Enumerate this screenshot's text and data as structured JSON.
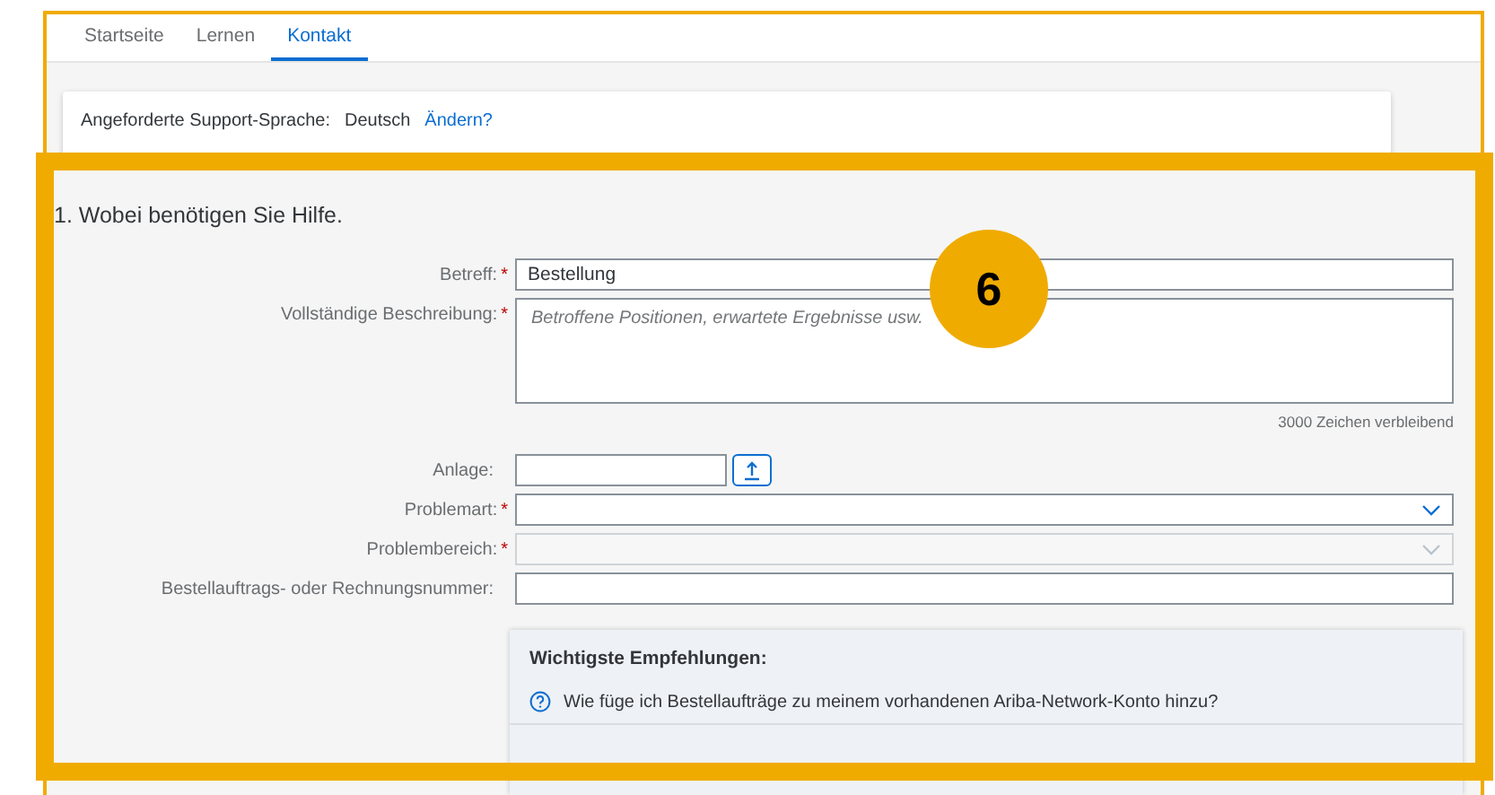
{
  "tabs": [
    {
      "label": "Startseite",
      "selected": false
    },
    {
      "label": "Lernen",
      "selected": false
    },
    {
      "label": "Kontakt",
      "selected": true
    }
  ],
  "language_notice": {
    "label": "Angeforderte Support-Sprache:",
    "value": "Deutsch",
    "link": "Ändern?"
  },
  "section_title": "1. Wobei benötigen Sie Hilfe.",
  "fields": [
    {
      "kind": "text",
      "label": "Betreff:",
      "required_mark": "*",
      "value": "Bestellung"
    },
    {
      "kind": "textarea",
      "label": "Vollständige Beschreibung:",
      "required_mark": "*",
      "placeholder": "Betroffene Positionen, erwartete Ergebnisse usw.",
      "counter": "3000 Zeichen verbleibend"
    },
    {
      "kind": "file",
      "label": "Anlage:"
    },
    {
      "kind": "select",
      "label": "Problemart:",
      "required_mark": "*",
      "disabled": false
    },
    {
      "kind": "select",
      "label": "Problembereich:",
      "required_mark": "*",
      "disabled": true
    },
    {
      "kind": "text",
      "label": "Bestellauftrags- oder Rechnungsnummer:"
    }
  ],
  "recommendations": {
    "title": "Wichtigste Empfehlungen:",
    "items": [
      "Wie füge ich Bestellaufträge zu meinem vorhandenen Ariba-Network-Konto hinzu?"
    ]
  },
  "callout_badge": "6"
}
